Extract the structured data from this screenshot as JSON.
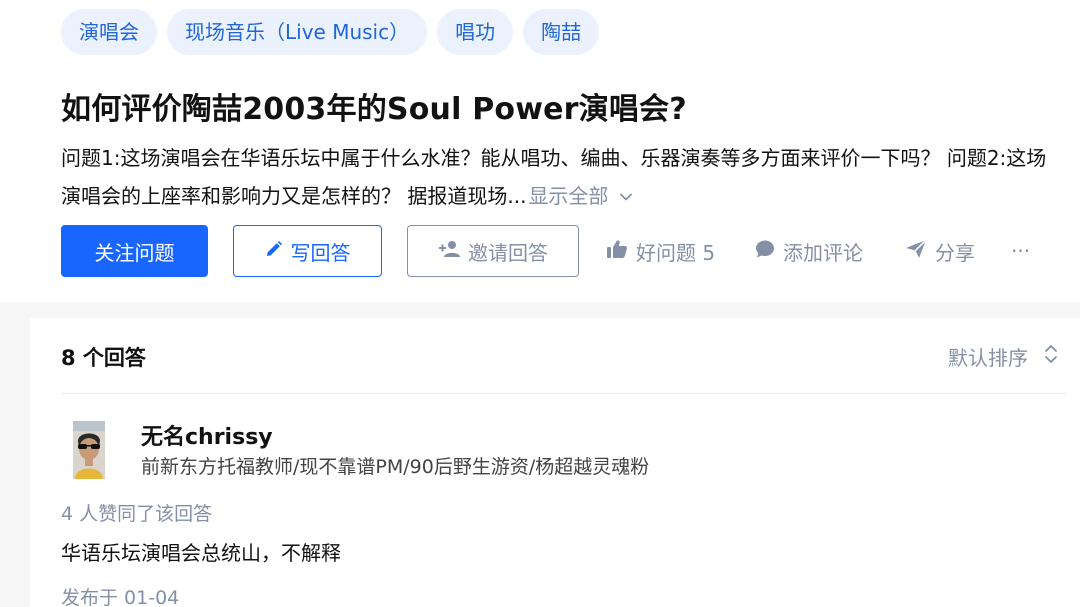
{
  "topics": [
    "演唱会",
    "现场音乐（Live Music）",
    "唱功",
    "陶喆"
  ],
  "question": {
    "title": "如何评价陶喆2003年的Soul Power演唱会?",
    "detail": "问题1:这场演唱会在华语乐坛中属于什么水准？能从唱功、编曲、乐器演奏等多方面来评价一下吗？ 问题2:这场演唱会的上座率和影响力又是怎样的？ 据报道现场...",
    "show_all": "显示全部"
  },
  "actions": {
    "follow": "关注问题",
    "write": "写回答",
    "invite": "邀请回答",
    "good_question": "好问题 5",
    "comment": "添加评论",
    "share": "分享",
    "more": "···"
  },
  "answers": {
    "count_label": "8 个回答",
    "sort_label": "默认排序",
    "items": [
      {
        "author": "无名chrissy",
        "bio": "前新东方托福教师/现不靠谱PM/90后野生游资/杨超越灵魂粉",
        "votes": "4 人赞同了该回答",
        "content": "华语乐坛演唱会总统山，不解释",
        "published": "发布于 01-04"
      }
    ]
  },
  "colors": {
    "brand_blue": "#1966ff",
    "tag_bg": "#ebf2fe",
    "tag_text": "#1f66d6",
    "muted": "#8590a6"
  }
}
